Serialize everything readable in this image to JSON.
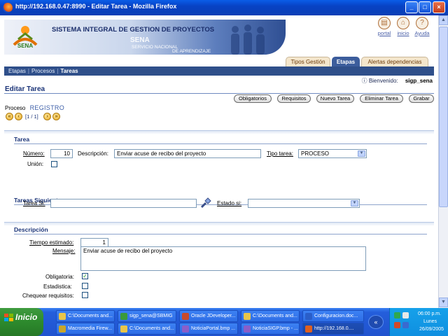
{
  "window": {
    "title": "http://192.168.0.47:8990 - Editar Tarea - Mozilla Firefox"
  },
  "header": {
    "brand": "SISTEMA INTEGRAL DE GESTION DE PROYECTOS",
    "logo_text": "SENA",
    "sub1": "SENA",
    "sub2": "SERVICIO NACIONAL",
    "sub3": "DE APRENDIZAJE",
    "links": [
      {
        "label": "portal",
        "icon": "book-icon"
      },
      {
        "label": "inicio",
        "icon": "home-icon"
      },
      {
        "label": "Ayuda",
        "icon": "help-icon"
      }
    ]
  },
  "tabs": [
    {
      "label": "Tipos Gestión"
    },
    {
      "label": "Etapas"
    },
    {
      "label": "Alertas dependencias"
    }
  ],
  "navbar": {
    "items": [
      "Etapas",
      "Procesos",
      "Tareas"
    ],
    "separator": "|"
  },
  "welcome": {
    "label": "Bienvenido:",
    "user": "sigp_sena"
  },
  "page": {
    "title": "Editar Tarea"
  },
  "actions": {
    "obligatorios": "Obligatorios",
    "requisitos": "Requisitos",
    "nuevo": "Nuevo Tarea",
    "eliminar": "Eliminar Tarea",
    "grabar": "Grabar"
  },
  "proceso": {
    "label": "Proceso",
    "value": "REGISTRO"
  },
  "pager": {
    "text": "[1 / 1]"
  },
  "tarea": {
    "section_title": "Tarea",
    "numero_label": "Número:",
    "numero_value": "10",
    "descripcion_label": "Descripción:",
    "descripcion_value": "Enviar acuse de recibo del proyecto",
    "tipo_label": "Tipo tarea:",
    "tipo_value": "PROCESO",
    "union_label": "Unión:"
  },
  "siguientes": {
    "section_title": "Tareas Siguientes",
    "tarea_si_label": "Tarea Si:",
    "tarea_si_value": "",
    "estado_si_label": "Estado si:",
    "estado_si_value": ""
  },
  "descripcion": {
    "section_title": "Descripción",
    "tiempo_label": "Tiempo estimado:",
    "tiempo_value": "1",
    "mensaje_label": "Mensaje:",
    "mensaje_value": "Enviar acuse de recibo del proyecto",
    "obligatoria_label": "Obligatoria:",
    "obligatoria_checked": true,
    "estadistica_label": "Estadistica:",
    "estadistica_checked": false,
    "chequear_label": "Chequear requisitos:",
    "chequear_checked": false
  },
  "taskbar": {
    "start": "Inicio",
    "row1": [
      {
        "label": "C:\\Documents and...",
        "color": "#e8c54a"
      },
      {
        "label": "sigp_sena@SBMIG",
        "color": "#3a9a3a"
      },
      {
        "label": "Oracle JDeveloper...",
        "color": "#c94a2a"
      },
      {
        "label": "C:\\Documents and...",
        "color": "#e8c54a"
      },
      {
        "label": "Configuracion.doc...",
        "color": "#2a5ec9"
      }
    ],
    "row2": [
      {
        "label": "Macromedia Firew...",
        "color": "#c9a62a"
      },
      {
        "label": "C:\\Documents and...",
        "color": "#e8c54a"
      },
      {
        "label": "NoticiaPortal.bmp ...",
        "color": "#8a5ec9"
      },
      {
        "label": "NoticiaSIGP.bmp - ...",
        "color": "#8a5ec9"
      },
      {
        "label": "http://192.168.0....",
        "color": "#e06020"
      }
    ],
    "time": "06:00 p.m.",
    "day": "Lunes",
    "date": "26/09/2005"
  }
}
